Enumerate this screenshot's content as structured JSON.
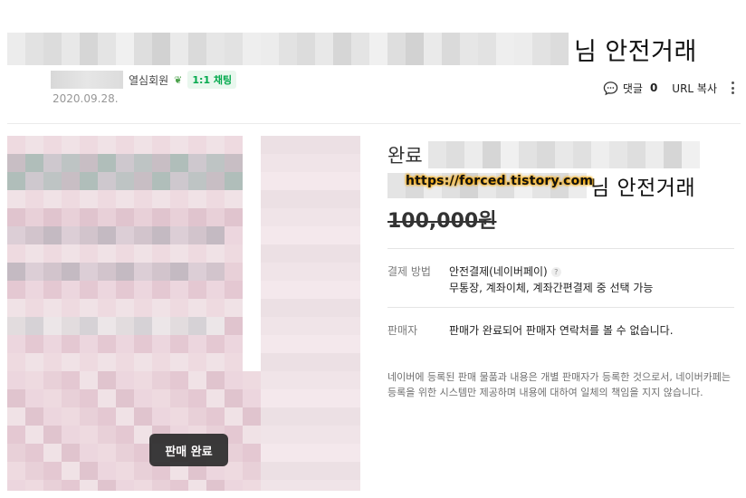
{
  "header": {
    "title_suffix": "님 안전거래",
    "author": {
      "grade": "열심회원",
      "grade_icon": "sprout-icon",
      "chat_label": "1:1 채팅"
    },
    "date": "2020.09.28.",
    "tools": {
      "comment_label": "댓글",
      "comment_count": "0",
      "url_copy_label": "URL 복사"
    }
  },
  "product": {
    "sold_badge": "판매 완료",
    "status": "완료",
    "title_suffix": "님 안전거래",
    "watermark": "https://forced.tistory.com",
    "price": "100,000원",
    "payment": {
      "label": "결제 방법",
      "method": "안전결제(네이버페이)",
      "options": "무통장, 계좌이체, 계좌간편결제 중 선택 가능"
    },
    "seller": {
      "label": "판매자",
      "value": "판매가 완료되어 판매자 연락처를 볼 수 없습니다."
    },
    "notice": "네이버에 등록된 판매 물품과 내용은 개별 판매자가 등록한 것으로서, 네이버카페는 등록을 위한 시스템만 제공하며 내용에 대하여 일체의 책임을 지지 않습니다."
  },
  "colors": {
    "chat_green": "#03a94d",
    "price_gray": "#333333",
    "divider": "#ebebeb"
  }
}
